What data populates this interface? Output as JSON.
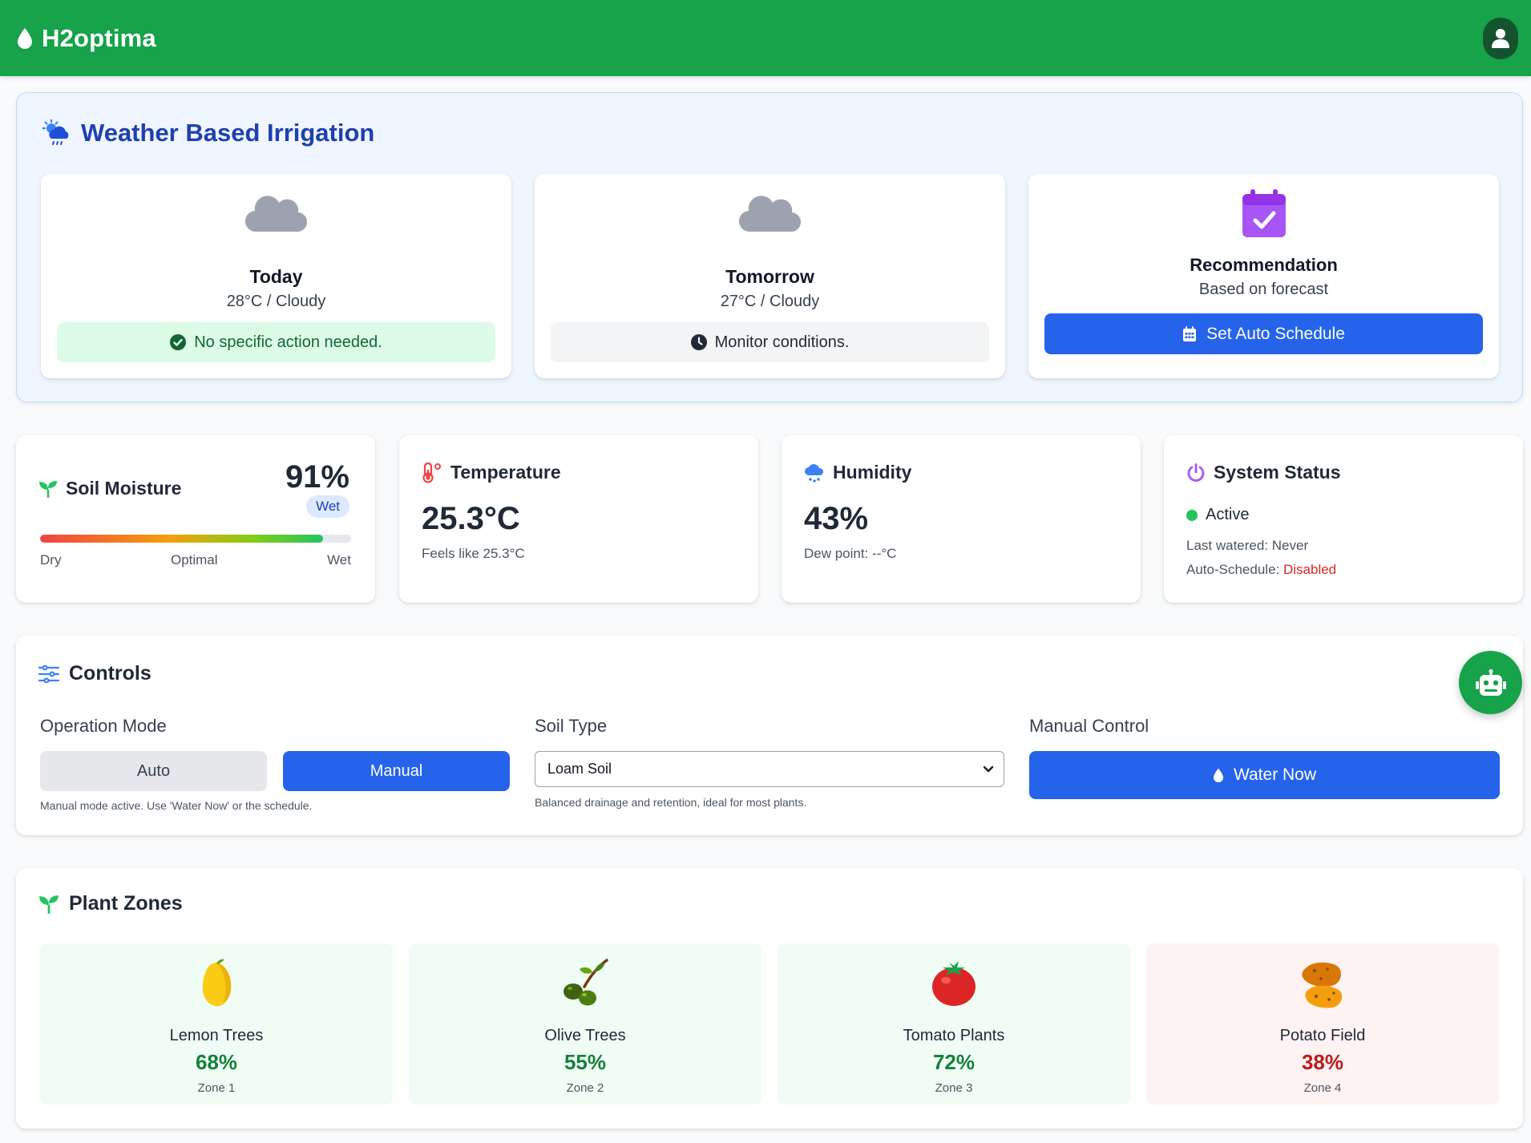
{
  "app": {
    "title": "H2optima",
    "colors": {
      "primary_green": "#16a34a",
      "primary_blue": "#2563eb",
      "danger": "#dc2626"
    }
  },
  "weather": {
    "heading": "Weather Based Irrigation",
    "today": {
      "label": "Today",
      "desc": "28°C / Cloudy",
      "status": "No specific action needed.",
      "icon": "cloud-icon"
    },
    "tomorrow": {
      "label": "Tomorrow",
      "desc": "27°C / Cloudy",
      "status": "Monitor conditions.",
      "icon": "cloud-icon"
    },
    "recommendation": {
      "title": "Recommendation",
      "subtitle": "Based on forecast",
      "button": "Set Auto Schedule"
    }
  },
  "stats": {
    "soil": {
      "title": "Soil Moisture",
      "value": "91%",
      "level": 91,
      "badge": "Wet",
      "scale": [
        "Dry",
        "Optimal",
        "Wet"
      ]
    },
    "temperature": {
      "title": "Temperature",
      "value": "25.3°C",
      "sub": "Feels like 25.3°C"
    },
    "humidity": {
      "title": "Humidity",
      "value": "43%",
      "sub": "Dew point: --°C"
    },
    "system": {
      "title": "System Status",
      "state": "Active",
      "last_watered": "Last watered: Never",
      "auto_label": "Auto-Schedule:",
      "auto_value": "Disabled"
    }
  },
  "controls": {
    "title": "Controls",
    "mode": {
      "label": "Operation Mode",
      "auto": "Auto",
      "manual": "Manual",
      "selected": "Manual",
      "help": "Manual mode active. Use 'Water Now' or the schedule."
    },
    "soil_type": {
      "label": "Soil Type",
      "selected": "Loam Soil",
      "help": "Balanced drainage and retention, ideal for most plants."
    },
    "manual": {
      "label": "Manual Control",
      "button": "Water Now"
    }
  },
  "zones": {
    "title": "Plant Zones",
    "items": [
      {
        "name": "Lemon Trees",
        "value": "68%",
        "zone": "Zone 1",
        "icon": "lemon-icon"
      },
      {
        "name": "Olive Trees",
        "value": "55%",
        "zone": "Zone 2",
        "icon": "olive-icon"
      },
      {
        "name": "Tomato Plants",
        "value": "72%",
        "zone": "Zone 3",
        "icon": "tomato-icon"
      },
      {
        "name": "Potato Field",
        "value": "38%",
        "zone": "Zone 4",
        "icon": "potato-icon"
      }
    ]
  }
}
